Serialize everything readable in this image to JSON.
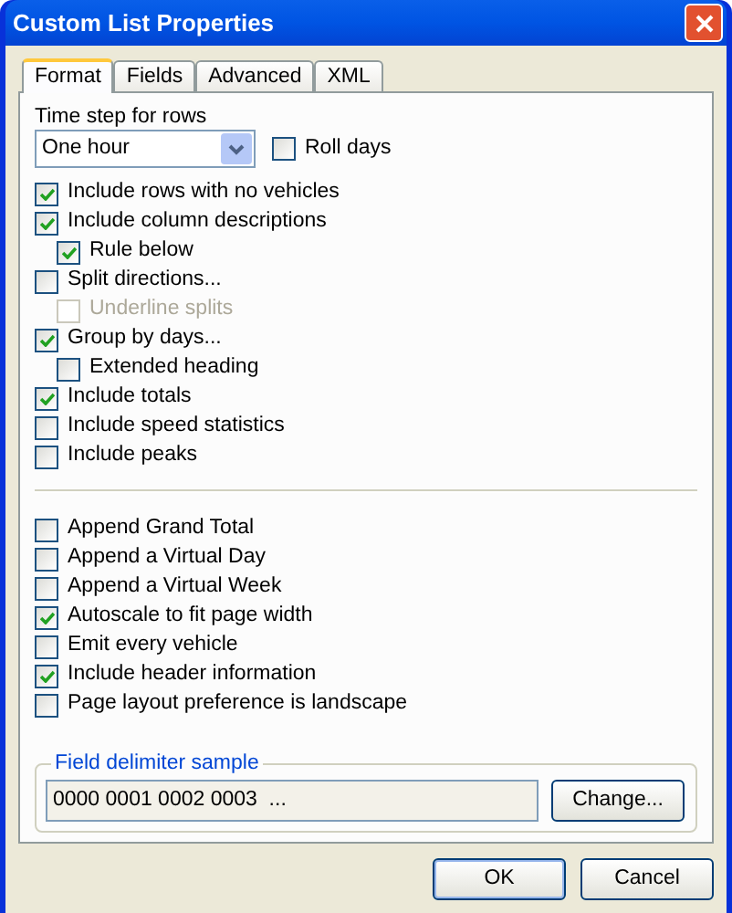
{
  "window": {
    "title": "Custom List Properties"
  },
  "tabs": [
    {
      "label": "Format",
      "selected": true
    },
    {
      "label": "Fields",
      "selected": false
    },
    {
      "label": "Advanced",
      "selected": false
    },
    {
      "label": "XML",
      "selected": false
    }
  ],
  "time_step": {
    "label": "Time step for rows",
    "value": "One hour"
  },
  "roll_days": {
    "label": "Roll days",
    "checked": false,
    "disabled": false
  },
  "options": [
    {
      "label": "Include rows with no vehicles",
      "checked": true,
      "disabled": false
    },
    {
      "label": "Include column descriptions",
      "checked": true,
      "disabled": false,
      "children": [
        {
          "label": "Rule below",
          "checked": true,
          "disabled": false
        }
      ]
    },
    {
      "label": "Split directions...",
      "checked": false,
      "disabled": false,
      "children": [
        {
          "label": "Underline splits",
          "checked": false,
          "disabled": true
        }
      ]
    },
    {
      "label": "Group by days...",
      "checked": true,
      "disabled": false,
      "children": [
        {
          "label": "Extended heading",
          "checked": false,
          "disabled": false
        }
      ]
    },
    {
      "label": "Include totals",
      "checked": true,
      "disabled": false
    },
    {
      "label": "Include speed statistics",
      "checked": false,
      "disabled": false
    },
    {
      "label": "Include peaks",
      "checked": false,
      "disabled": false
    }
  ],
  "extra_options": [
    {
      "label": "Append Grand Total",
      "checked": false,
      "disabled": false
    },
    {
      "label": "Append a Virtual Day",
      "checked": false,
      "disabled": false
    },
    {
      "label": "Append a Virtual Week",
      "checked": false,
      "disabled": false
    },
    {
      "label": "Autoscale to fit page width",
      "checked": true,
      "disabled": false
    },
    {
      "label": "Emit every vehicle",
      "checked": false,
      "disabled": false
    },
    {
      "label": "Include header information",
      "checked": true,
      "disabled": false
    },
    {
      "label": "Page layout preference is landscape",
      "checked": false,
      "disabled": false
    }
  ],
  "delimiter": {
    "title": "Field delimiter sample",
    "value": "0000 0001 0002 0003  ...",
    "button": "Change..."
  },
  "buttons": [
    "OK",
    "Cancel"
  ]
}
